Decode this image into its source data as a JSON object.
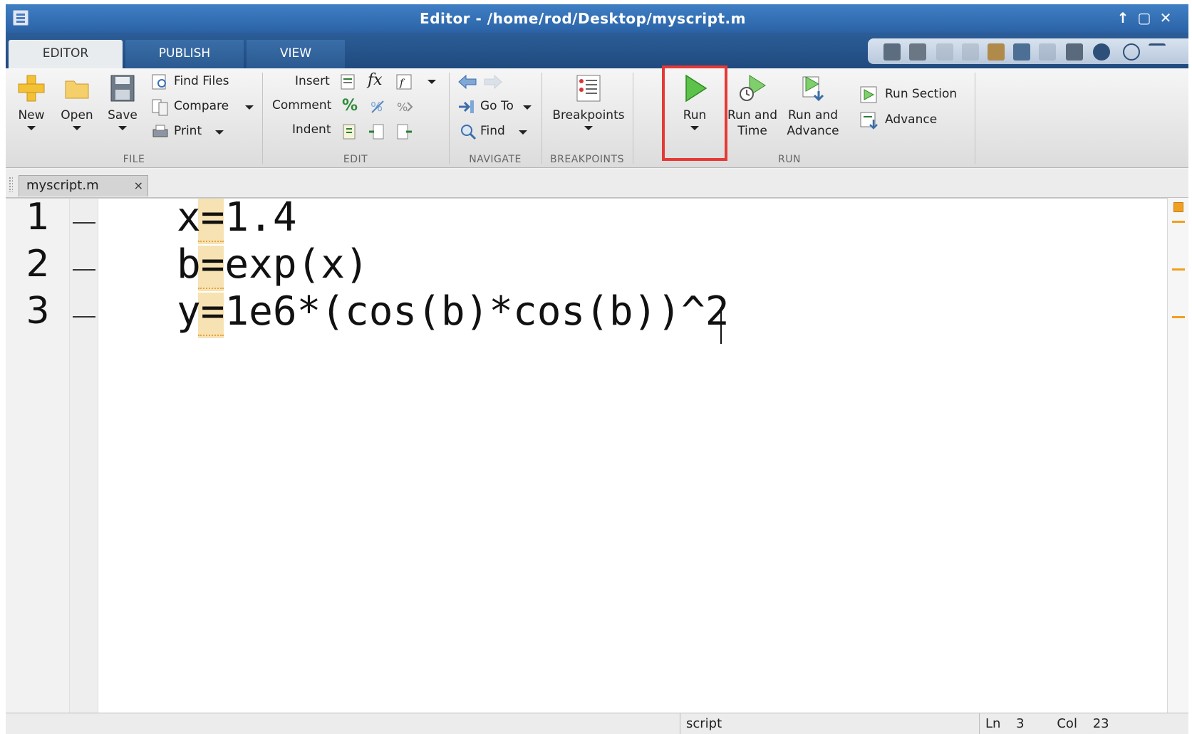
{
  "window": {
    "title": "Editor - /home/rod/Desktop/myscript.m"
  },
  "ribbon_tabs": [
    {
      "label": "EDITOR",
      "active": true
    },
    {
      "label": "PUBLISH",
      "active": false
    },
    {
      "label": "VIEW",
      "active": false
    }
  ],
  "file": {
    "section_label": "FILE",
    "new_label": "New",
    "open_label": "Open",
    "save_label": "Save",
    "find_files_label": "Find Files",
    "compare_label": "Compare",
    "print_label": "Print"
  },
  "edit": {
    "section_label": "EDIT",
    "insert_label": "Insert",
    "comment_label": "Comment",
    "indent_label": "Indent",
    "fx_glyph": "fx",
    "percent_glyph": "%"
  },
  "navigate": {
    "section_label": "NAVIGATE",
    "goto_label": "Go To",
    "find_label": "Find"
  },
  "breakpoints": {
    "section_label": "BREAKPOINTS",
    "button_label": "Breakpoints"
  },
  "run": {
    "section_label": "RUN",
    "run_label": "Run",
    "run_time_line1": "Run and",
    "run_time_line2": "Time",
    "run_adv_line1": "Run and",
    "run_adv_line2": "Advance",
    "run_section_label": "Run Section",
    "advance_label": "Advance"
  },
  "document_tab": {
    "label": "myscript.m",
    "close_glyph": "×"
  },
  "code_lines": [
    {
      "number": "1",
      "text": "x=1.4"
    },
    {
      "number": "2",
      "text": "b=exp(x)"
    },
    {
      "number": "3",
      "text": "y=1e6*(cos(b)*cos(b))^2"
    }
  ],
  "status": {
    "mode": "script",
    "ln_label": "Ln",
    "ln_value": "3",
    "col_label": "Col",
    "col_value": "23"
  },
  "colors": {
    "highlight_box": "#e53935",
    "warning_marker": "#f0a020",
    "titlebar": "#2b62a6"
  }
}
